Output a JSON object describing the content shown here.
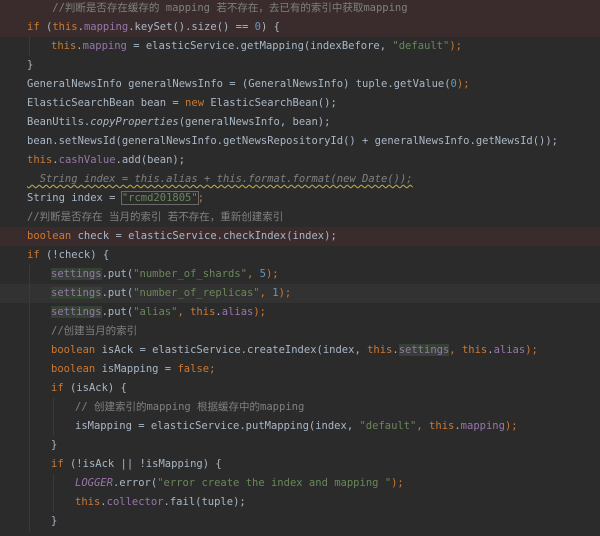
{
  "editor": {
    "language": "java",
    "theme": "dark",
    "colors": {
      "background": "#2b2b2b",
      "keyword": "#cc7832",
      "string": "#6a8759",
      "number": "#6897bb",
      "field": "#9876aa",
      "comment": "#808080",
      "error_line": "#3a2c2c"
    },
    "lines": [
      {
        "indent": 0,
        "bg": "red",
        "tokens": [
          {
            "t": "    //判断是否存在缓存的 mapping 若不存在，去已有的索引中获取mapping",
            "c": "cmt"
          }
        ]
      },
      {
        "indent": 0,
        "bg": "red",
        "tokens": [
          {
            "t": "if",
            "c": "kw"
          },
          {
            "t": " (",
            "c": "plain"
          },
          {
            "t": "this",
            "c": "kw"
          },
          {
            "t": ".",
            "c": "plain"
          },
          {
            "t": "mapping",
            "c": "fld"
          },
          {
            "t": ".keySet().size() == ",
            "c": "plain"
          },
          {
            "t": "0",
            "c": "num"
          },
          {
            "t": ") {",
            "c": "plain"
          }
        ]
      },
      {
        "indent": 1,
        "bg": "",
        "tokens": [
          {
            "t": "this",
            "c": "kw"
          },
          {
            "t": ".",
            "c": "plain"
          },
          {
            "t": "mapping",
            "c": "fld"
          },
          {
            "t": " = elasticService.getMapping(indexBefore, ",
            "c": "plain"
          },
          {
            "t": "\"default\"",
            "c": "str"
          },
          {
            "t": ");",
            "c": "kw"
          }
        ]
      },
      {
        "indent": 0,
        "bg": "",
        "tokens": [
          {
            "t": "}",
            "c": "plain"
          }
        ]
      },
      {
        "indent": 0,
        "bg": "",
        "tokens": [
          {
            "t": "GeneralNewsInfo generalNewsInfo = (GeneralNewsInfo) tuple.getValue(",
            "c": "plain"
          },
          {
            "t": "0",
            "c": "num"
          },
          {
            "t": ");",
            "c": "kw"
          }
        ]
      },
      {
        "indent": 0,
        "bg": "",
        "tokens": [
          {
            "t": "ElasticSearchBean bean = ",
            "c": "plain"
          },
          {
            "t": "new",
            "c": "kw"
          },
          {
            "t": " ElasticSearchBean();",
            "c": "plain"
          }
        ]
      },
      {
        "indent": 0,
        "bg": "",
        "tokens": [
          {
            "t": "BeanUtils.",
            "c": "plain"
          },
          {
            "t": "copyProperties",
            "c": "it"
          },
          {
            "t": "(generalNewsInfo, bean);",
            "c": "plain"
          }
        ]
      },
      {
        "indent": 0,
        "bg": "",
        "tokens": [
          {
            "t": "bean.setNewsId(generalNewsInfo.getNewsRepositoryId() + generalNewsInfo.getNewsId());",
            "c": "plain"
          }
        ]
      },
      {
        "indent": 0,
        "bg": "",
        "tokens": [
          {
            "t": "this",
            "c": "kw"
          },
          {
            "t": ".",
            "c": "plain"
          },
          {
            "t": "cashValue",
            "c": "fld"
          },
          {
            "t": ".add(bean);",
            "c": "plain"
          }
        ]
      },
      {
        "indent": 0,
        "bg": "",
        "tokens": [
          {
            "t": "  String index = this.alias + this.format.format(new Date());",
            "c": "cmt-sq"
          }
        ]
      },
      {
        "indent": 0,
        "bg": "",
        "tokens": [
          {
            "t": "String index = ",
            "c": "plain"
          },
          {
            "t": "\"rcmd201805\"",
            "c": "str-box"
          },
          {
            "t": ";",
            "c": "kw"
          }
        ]
      },
      {
        "indent": 0,
        "bg": "",
        "tokens": [
          {
            "t": "//判断是否存在 当月的索引 若不存在，重新创建索引",
            "c": "cmt"
          }
        ]
      },
      {
        "indent": 0,
        "bg": "red",
        "tokens": [
          {
            "t": "boolean",
            "c": "kw"
          },
          {
            "t": " check = elasticService.checkIndex(index);",
            "c": "plain"
          }
        ]
      },
      {
        "indent": 0,
        "bg": "",
        "tokens": [
          {
            "t": "if",
            "c": "kw"
          },
          {
            "t": " (!check) {",
            "c": "plain"
          }
        ]
      },
      {
        "indent": 1,
        "bg": "",
        "tokens": [
          {
            "t": "settings",
            "c": "fld-hl"
          },
          {
            "t": ".put(",
            "c": "plain"
          },
          {
            "t": "\"number_of_shards\"",
            "c": "str"
          },
          {
            "t": ", ",
            "c": "kw"
          },
          {
            "t": "5",
            "c": "num"
          },
          {
            "t": ");",
            "c": "kw"
          }
        ]
      },
      {
        "indent": 1,
        "bg": "cur",
        "tokens": [
          {
            "t": "settings",
            "c": "fld-hl"
          },
          {
            "t": ".put(",
            "c": "plain"
          },
          {
            "t": "\"number_of_replicas\"",
            "c": "str"
          },
          {
            "t": ", ",
            "c": "kw"
          },
          {
            "t": "1",
            "c": "num"
          },
          {
            "t": ");",
            "c": "kw"
          }
        ]
      },
      {
        "indent": 1,
        "bg": "",
        "tokens": [
          {
            "t": "settings",
            "c": "fld-hl"
          },
          {
            "t": ".put(",
            "c": "plain"
          },
          {
            "t": "\"alias\"",
            "c": "str"
          },
          {
            "t": ", ",
            "c": "kw"
          },
          {
            "t": "this",
            "c": "kw"
          },
          {
            "t": ".",
            "c": "plain"
          },
          {
            "t": "alias",
            "c": "fld"
          },
          {
            "t": ");",
            "c": "kw"
          }
        ]
      },
      {
        "indent": 1,
        "bg": "",
        "tokens": [
          {
            "t": "//创建当月的索引",
            "c": "cmt"
          }
        ]
      },
      {
        "indent": 1,
        "bg": "",
        "tokens": [
          {
            "t": "boolean",
            "c": "kw"
          },
          {
            "t": " isAck = elasticService.createIndex(index, ",
            "c": "plain"
          },
          {
            "t": "this",
            "c": "kw"
          },
          {
            "t": ".",
            "c": "plain"
          },
          {
            "t": "settings",
            "c": "fld-hl"
          },
          {
            "t": ", ",
            "c": "kw"
          },
          {
            "t": "this",
            "c": "kw"
          },
          {
            "t": ".",
            "c": "plain"
          },
          {
            "t": "alias",
            "c": "fld"
          },
          {
            "t": ");",
            "c": "kw"
          }
        ]
      },
      {
        "indent": 1,
        "bg": "",
        "tokens": [
          {
            "t": "boolean",
            "c": "kw"
          },
          {
            "t": " isMapping = ",
            "c": "plain"
          },
          {
            "t": "false",
            "c": "kw"
          },
          {
            "t": ";",
            "c": "kw"
          }
        ]
      },
      {
        "indent": 1,
        "bg": "",
        "tokens": [
          {
            "t": "if",
            "c": "kw"
          },
          {
            "t": " (isAck) {",
            "c": "plain"
          }
        ]
      },
      {
        "indent": 2,
        "bg": "",
        "tokens": [
          {
            "t": "// 创建索引的mapping 根据缓存中的mapping",
            "c": "cmt"
          }
        ]
      },
      {
        "indent": 2,
        "bg": "",
        "tokens": [
          {
            "t": "isMapping = elasticService.putMapping(index, ",
            "c": "plain"
          },
          {
            "t": "\"default\"",
            "c": "str"
          },
          {
            "t": ", ",
            "c": "kw"
          },
          {
            "t": "this",
            "c": "kw"
          },
          {
            "t": ".",
            "c": "plain"
          },
          {
            "t": "mapping",
            "c": "fld"
          },
          {
            "t": ");",
            "c": "kw"
          }
        ]
      },
      {
        "indent": 1,
        "bg": "",
        "tokens": [
          {
            "t": "}",
            "c": "plain"
          }
        ]
      },
      {
        "indent": 1,
        "bg": "",
        "tokens": [
          {
            "t": "if",
            "c": "kw"
          },
          {
            "t": " (!isAck || !isMapping) {",
            "c": "plain"
          }
        ]
      },
      {
        "indent": 2,
        "bg": "",
        "tokens": [
          {
            "t": "LOGGER",
            "c": "fld-it"
          },
          {
            "t": ".error(",
            "c": "plain"
          },
          {
            "t": "\"error create the index and mapping \"",
            "c": "str"
          },
          {
            "t": ");",
            "c": "kw"
          }
        ]
      },
      {
        "indent": 2,
        "bg": "",
        "tokens": [
          {
            "t": "this",
            "c": "kw"
          },
          {
            "t": ".",
            "c": "plain"
          },
          {
            "t": "collector",
            "c": "fld"
          },
          {
            "t": ".fail(tuple);",
            "c": "plain"
          }
        ]
      },
      {
        "indent": 1,
        "bg": "",
        "tokens": [
          {
            "t": "}",
            "c": "plain"
          }
        ]
      }
    ]
  }
}
